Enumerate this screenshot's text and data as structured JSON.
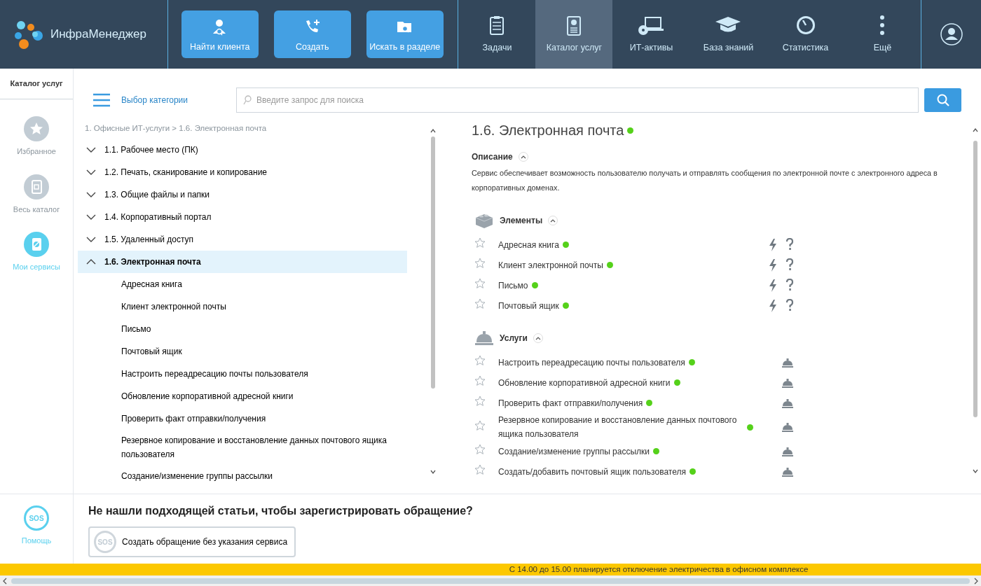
{
  "app": {
    "name": "ИнфраМенеджер"
  },
  "quick_actions": [
    {
      "label": "Найти клиента",
      "kind": "person"
    },
    {
      "label": "Создать",
      "kind": "call"
    },
    {
      "label": "Искать в разделе",
      "kind": "folder"
    }
  ],
  "nav": [
    {
      "label": "Задачи",
      "kind": "tasks",
      "selected": false
    },
    {
      "label": "Каталог услуг",
      "kind": "catalog",
      "selected": true
    },
    {
      "label": "ИТ-активы",
      "kind": "assets",
      "selected": false
    },
    {
      "label": "База знаний",
      "kind": "knowledge",
      "selected": false
    },
    {
      "label": "Статистика",
      "kind": "stats",
      "selected": false
    },
    {
      "label": "Ещё",
      "kind": "more",
      "selected": false
    }
  ],
  "sidebar": {
    "title": "Каталог услуг",
    "items": [
      {
        "label": "Избранное",
        "kind": "star",
        "selected": false
      },
      {
        "label": "Весь каталог",
        "kind": "book",
        "selected": false
      },
      {
        "label": "Мои сервисы",
        "kind": "mine",
        "selected": true
      }
    ],
    "help": {
      "icon_text": "SOS",
      "label": "Помощь"
    }
  },
  "category_button": "Выбор категории",
  "search": {
    "placeholder": "Введите запрос для поиска"
  },
  "breadcrumb": "1. Офисные ИТ-услуги > 1.6. Электронная почта",
  "tree": [
    {
      "label": "1.1. Рабочее место (ПК)",
      "expanded": false,
      "selected": false
    },
    {
      "label": "1.2. Печать, сканирование и копирование",
      "expanded": false,
      "selected": false
    },
    {
      "label": "1.3. Общие файлы и папки",
      "expanded": false,
      "selected": false
    },
    {
      "label": "1.4. Корпоративный портал",
      "expanded": false,
      "selected": false
    },
    {
      "label": "1.5. Удаленный доступ",
      "expanded": false,
      "selected": false
    },
    {
      "label": "1.6. Электронная почта",
      "expanded": true,
      "selected": true,
      "children": [
        {
          "label": "Адресная книга"
        },
        {
          "label": "Клиент электронной почты"
        },
        {
          "label": "Письмо"
        },
        {
          "label": "Почтовый ящик"
        },
        {
          "label": "Настроить переадресацию почты пользователя"
        },
        {
          "label": "Обновление корпоративной адресной книги"
        },
        {
          "label": "Проверить факт отправки/получения"
        },
        {
          "label": "Резервное копирование и восстановление данных почтового ящика пользователя"
        },
        {
          "label": "Создание/изменение группы рассылки"
        }
      ]
    }
  ],
  "detail": {
    "title": "1.6. Электронная почта",
    "description": {
      "heading": "Описание",
      "expanded": true,
      "text": "Сервис обеспечивает возможность пользователю получать и отправлять сообщения по электронной почте с электронного адреса в корпоративных доменах."
    },
    "sections": [
      {
        "heading": "Элементы",
        "kind": "elements",
        "expanded": true,
        "items": [
          {
            "label": "Адресная книга",
            "favorite": false
          },
          {
            "label": "Клиент электронной почты",
            "favorite": false
          },
          {
            "label": "Письмо",
            "favorite": false
          },
          {
            "label": "Почтовый ящик",
            "favorite": false
          }
        ]
      },
      {
        "heading": "Услуги",
        "kind": "services",
        "expanded": true,
        "items": [
          {
            "label": "Настроить переадресацию почты пользователя",
            "favorite": false
          },
          {
            "label": "Обновление корпоративной адресной книги",
            "favorite": false
          },
          {
            "label": "Проверить факт отправки/получения",
            "favorite": false
          },
          {
            "label": "Резервное копирование и восстановление данных почтового ящика пользователя",
            "favorite": false
          },
          {
            "label": "Создание/изменение группы рассылки",
            "favorite": false
          },
          {
            "label": "Создать/добавить почтовый ящик пользователя",
            "favorite": false
          }
        ]
      }
    ]
  },
  "footer": {
    "question": "Не нашли подходящей статьи, чтобы зарегистрировать обращение?",
    "button": {
      "icon_text": "SOS",
      "label": "Создать обращение без указания сервиса"
    }
  },
  "notice": "С 14.00 до 15.00 планируется отключение электричества в офисном комплексе"
}
